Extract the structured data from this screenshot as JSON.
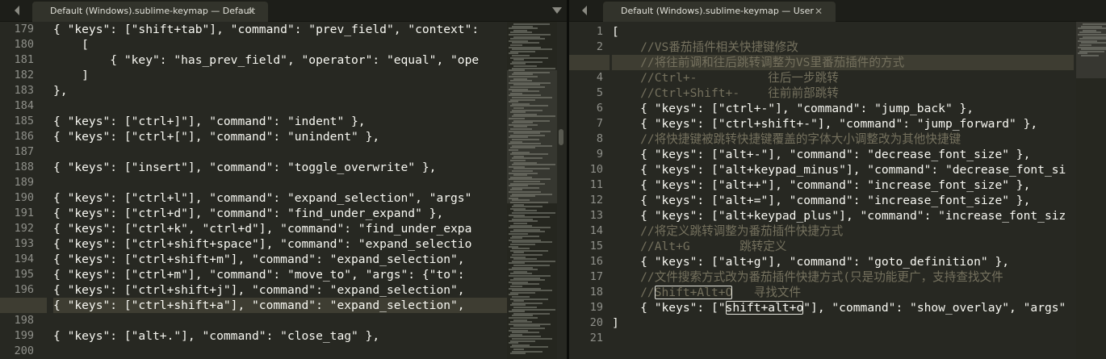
{
  "left_pane": {
    "tab_title": "Default (Windows).sublime-keymap — Default",
    "close_glyph": "✕",
    "current_line": "197",
    "line_numbers": [
      "179",
      "180",
      "181",
      "182",
      "183",
      "184",
      "185",
      "186",
      "187",
      "188",
      "189",
      "190",
      "191",
      "192",
      "193",
      "194",
      "195",
      "196",
      "197",
      "198",
      "199",
      "200"
    ],
    "lines": [
      "{ \"keys\": [\"shift+tab\"], \"command\": \"prev_field\", \"context\":",
      "    [",
      "        { \"key\": \"has_prev_field\", \"operator\": \"equal\", \"ope",
      "    ]",
      "},",
      "",
      "{ \"keys\": [\"ctrl+]\"], \"command\": \"indent\" },",
      "{ \"keys\": [\"ctrl+[\"], \"command\": \"unindent\" },",
      "",
      "{ \"keys\": [\"insert\"], \"command\": \"toggle_overwrite\" },",
      "",
      "{ \"keys\": [\"ctrl+l\"], \"command\": \"expand_selection\", \"args\"",
      "{ \"keys\": [\"ctrl+d\"], \"command\": \"find_under_expand\" },",
      "{ \"keys\": [\"ctrl+k\", \"ctrl+d\"], \"command\": \"find_under_expa",
      "{ \"keys\": [\"ctrl+shift+space\"], \"command\": \"expand_selectio",
      "{ \"keys\": [\"ctrl+shift+m\"], \"command\": \"expand_selection\",",
      "{ \"keys\": [\"ctrl+m\"], \"command\": \"move_to\", \"args\": {\"to\":",
      "{ \"keys\": [\"ctrl+shift+j\"], \"command\": \"expand_selection\",",
      "{ \"keys\": [\"ctrl+shift+a\"], \"command\": \"expand_selection\",",
      "",
      "{ \"keys\": [\"alt+.\"], \"command\": \"close_tag\" },",
      ""
    ]
  },
  "right_pane": {
    "tab_title": "Default (Windows).sublime-keymap — User",
    "close_glyph": "✕",
    "current_line": "3",
    "line_numbers": [
      "1",
      "2",
      "3",
      "4",
      "5",
      "6",
      "7",
      "8",
      "9",
      "10",
      "11",
      "12",
      "13",
      "14",
      "15",
      "16",
      "17",
      "18",
      "19",
      "20",
      "21"
    ],
    "lines": [
      {
        "t": "[",
        "k": "p"
      },
      {
        "t": "    //VS番茄插件相关快捷键修改",
        "k": "c"
      },
      {
        "t": "    //将往前调和往后跳转调整为VS里番茄插件的方式",
        "k": "c"
      },
      {
        "t": "    //Ctrl+-          往后一步跳转",
        "k": "c"
      },
      {
        "t": "    //Ctrl+Shift+-    往前前部跳转",
        "k": "c"
      },
      {
        "t": "    { \"keys\": [\"ctrl+-\"], \"command\": \"jump_back\" },",
        "k": "p"
      },
      {
        "t": "    { \"keys\": [\"ctrl+shift+-\"], \"command\": \"jump_forward\" },",
        "k": "p"
      },
      {
        "t": "    //将快捷键被跳转快捷键覆盖的字体大小调整改为其他快捷键",
        "k": "c"
      },
      {
        "t": "    { \"keys\": [\"alt+-\"], \"command\": \"decrease_font_size\" },",
        "k": "p"
      },
      {
        "t": "    { \"keys\": [\"alt+keypad_minus\"], \"command\": \"decrease_font_si",
        "k": "p"
      },
      {
        "t": "    { \"keys\": [\"alt++\"], \"command\": \"increase_font_size\" },",
        "k": "p"
      },
      {
        "t": "    { \"keys\": [\"alt+=\"], \"command\": \"increase_font_size\" },",
        "k": "p"
      },
      {
        "t": "    { \"keys\": [\"alt+keypad_plus\"], \"command\": \"increase_font_siz",
        "k": "p"
      },
      {
        "t": "    //将定义跳转调整为番茄插件快捷方式",
        "k": "c"
      },
      {
        "t": "    //Alt+G       跳转定义",
        "k": "c"
      },
      {
        "t": "    { \"keys\": [\"alt+g\"], \"command\": \"goto_definition\" },",
        "k": "p"
      },
      {
        "t": "    //文件搜索方式改为番茄插件快捷方式(只是功能更广，支持查找文件",
        "k": "c"
      },
      {
        "t": "    //Shift+Alt+O   寻找文件",
        "k": "c",
        "box": "Shift+Alt+O"
      },
      {
        "t": "    { \"keys\": [\"shift+alt+o\"], \"command\": \"show_overlay\", \"args\"",
        "k": "p",
        "box": "shift+alt+o"
      },
      {
        "t": "]",
        "k": "p"
      },
      {
        "t": "",
        "k": "p"
      }
    ]
  },
  "colors": {
    "background": "#272822",
    "comment": "#75715e",
    "text": "#f8f8f2",
    "line_number": "#8f908a",
    "tab_bar": "#1d1e19"
  }
}
